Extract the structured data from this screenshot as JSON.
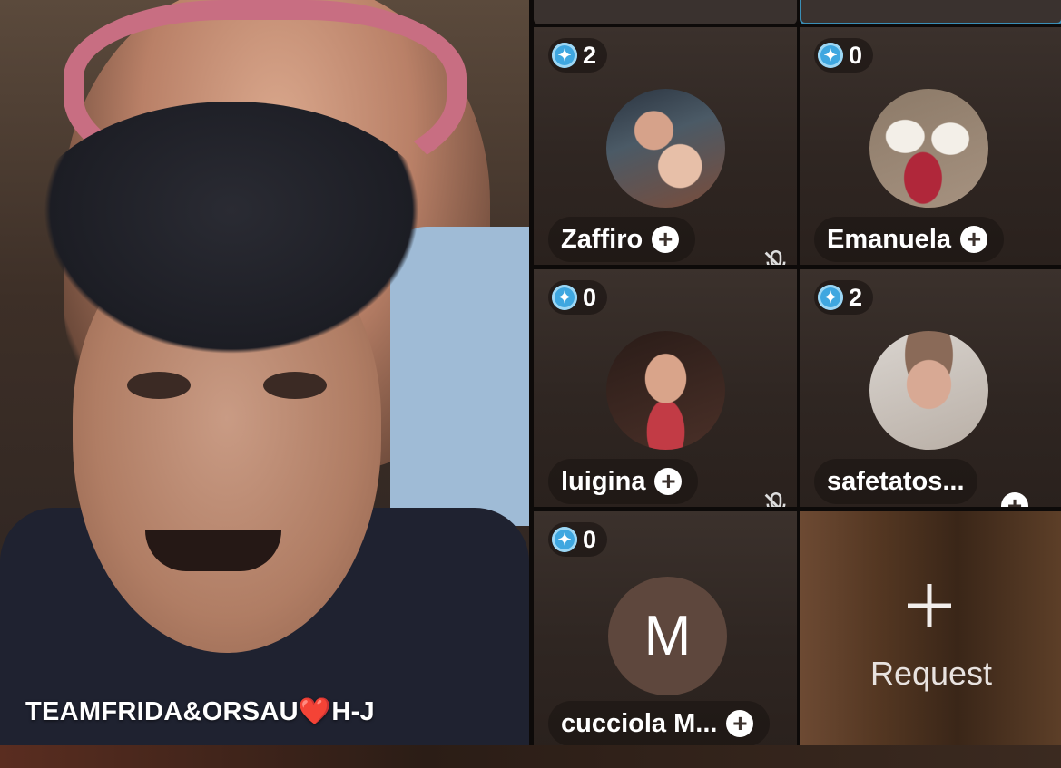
{
  "host": {
    "name": "TEAMFRIDA&ORSAU❤️H-J"
  },
  "guests": [
    {
      "name": "Zaffiro",
      "score": "2",
      "muted": true
    },
    {
      "name": "Emanuela",
      "score": "0",
      "muted": false
    },
    {
      "name": "luigina",
      "score": "0",
      "muted": true
    },
    {
      "name": "safetatos...",
      "score": "2",
      "muted": false
    },
    {
      "name": "cucciola M...",
      "score": "0",
      "avatar_letter": "M",
      "muted": false
    }
  ],
  "request": {
    "label": "Request"
  },
  "colors": {
    "gem": "#3fa7e0",
    "tile_bg": "#2f2622",
    "active_border": "#3a8fb7"
  },
  "icons": {
    "add": "plus-icon",
    "muted": "mic-off-icon",
    "score": "gem-icon"
  }
}
